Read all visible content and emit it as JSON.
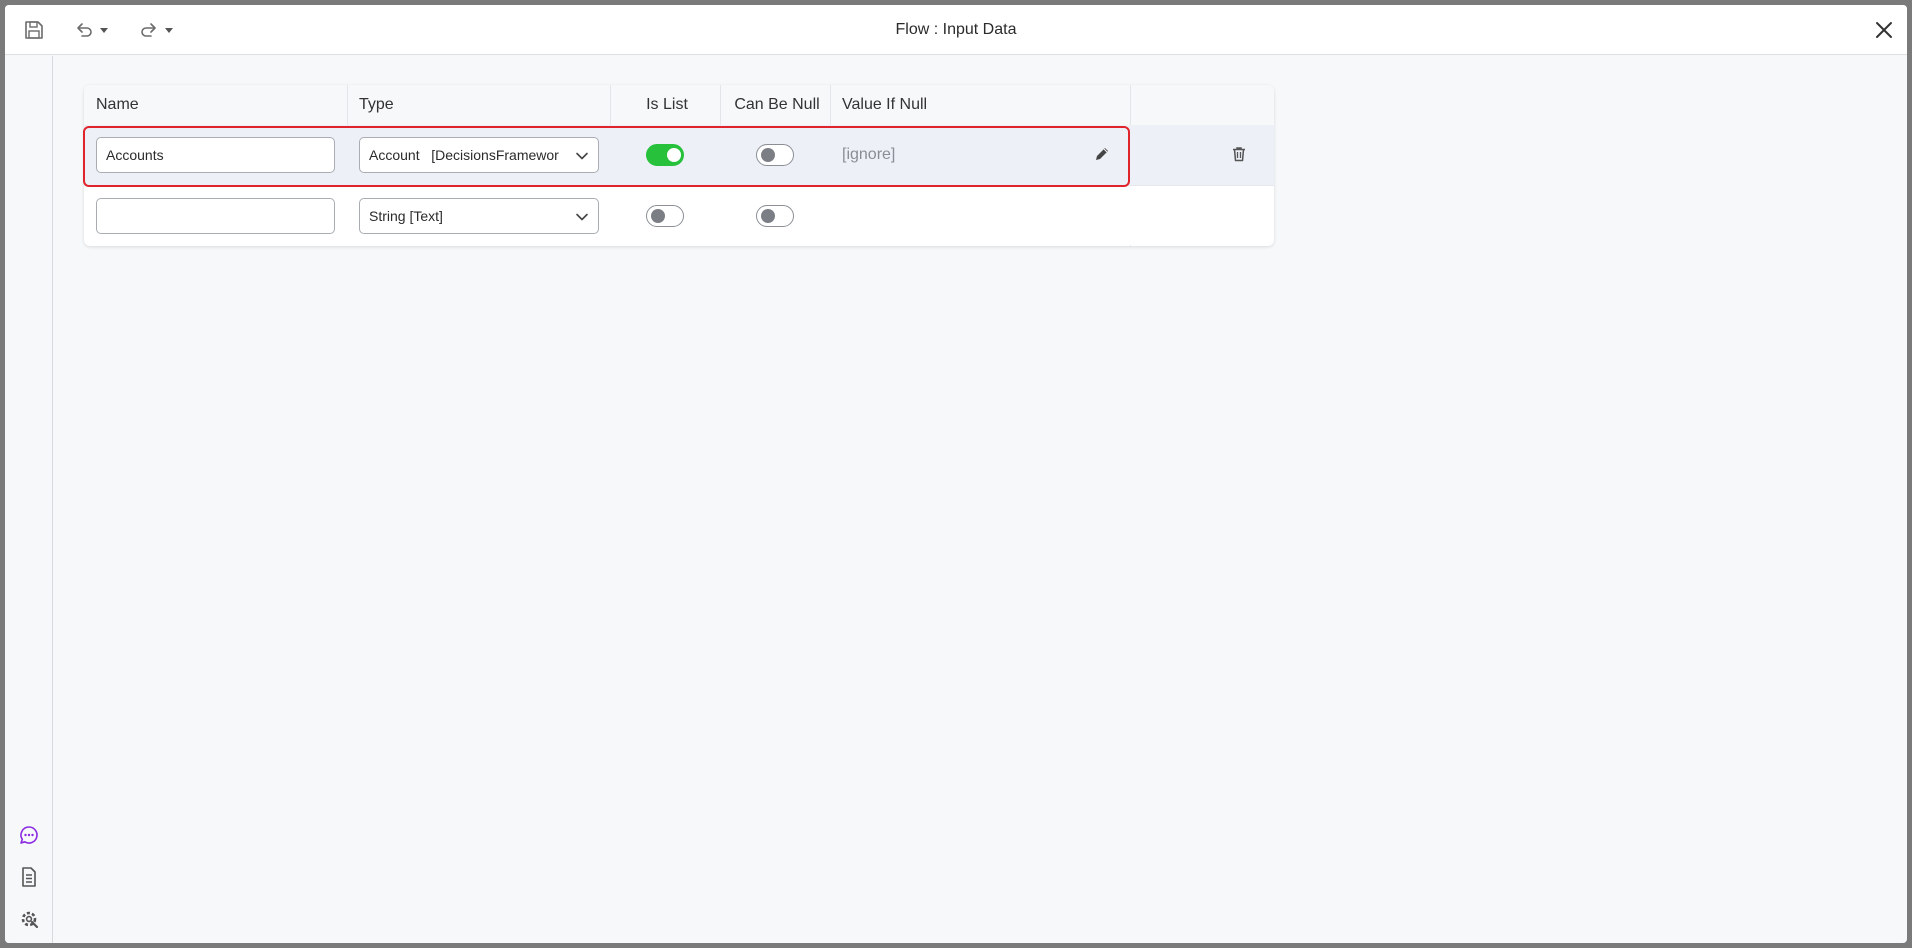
{
  "window": {
    "title": "Flow : Input Data"
  },
  "toolbar": {
    "save_icon": "save-icon",
    "undo_icon": "undo-icon",
    "redo_icon": "redo-icon",
    "close_icon": "close-icon"
  },
  "sidebar": {
    "items": [
      {
        "icon": "chat-icon",
        "color": "#8a2be2"
      },
      {
        "icon": "document-icon",
        "color": "#555555"
      },
      {
        "icon": "settings-icon",
        "color": "#555555"
      }
    ]
  },
  "table": {
    "columns": [
      "Name",
      "Type",
      "Is List",
      "Can Be Null",
      "Value If Null"
    ],
    "rows": [
      {
        "name": "Accounts",
        "type": "Account   [DecisionsFramewor",
        "is_list": true,
        "can_be_null": false,
        "value_if_null": "[ignore]",
        "selected": true
      },
      {
        "name": "",
        "type": "String [Text]",
        "is_list": false,
        "can_be_null": false,
        "value_if_null": "",
        "selected": false
      }
    ]
  },
  "colors": {
    "toggle_on": "#27c13b",
    "selection_border": "#e0242b",
    "selected_row_bg": "#eef0f8"
  }
}
